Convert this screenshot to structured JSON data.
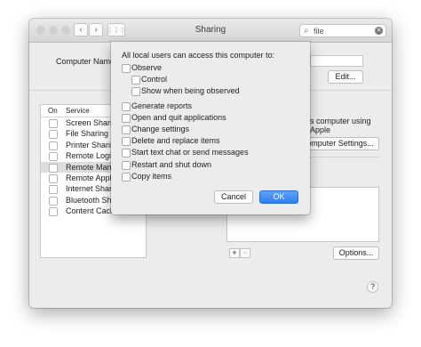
{
  "window": {
    "title": "Sharing",
    "search_value": "file",
    "nav_back": "‹",
    "nav_forward": "›",
    "grid": "⋮⋮⋮"
  },
  "colors": {
    "close": "#fc605c",
    "minimize": "#fdbc40",
    "zoom": "#34c84a",
    "accent": "#2f7ef2"
  },
  "computer_name": {
    "label": "Computer Name:",
    "edit_button": "Edit..."
  },
  "services": {
    "header_on": "On",
    "header_service": "Service",
    "items": [
      {
        "name": "Screen Sharing",
        "on": false,
        "selected": false
      },
      {
        "name": "File Sharing",
        "on": false,
        "selected": false
      },
      {
        "name": "Printer Sharing",
        "on": false,
        "selected": false
      },
      {
        "name": "Remote Login",
        "on": false,
        "selected": false
      },
      {
        "name": "Remote Manag",
        "on": false,
        "selected": true
      },
      {
        "name": "Remote Apple",
        "on": false,
        "selected": false
      },
      {
        "name": "Internet Sharing",
        "on": false,
        "selected": false
      },
      {
        "name": "Bluetooth Shar",
        "on": false,
        "selected": false
      },
      {
        "name": "Content Cachin",
        "on": false,
        "selected": false
      }
    ]
  },
  "detail": {
    "partial_text": "s computer using Apple",
    "computer_settings_button": "omputer Settings...",
    "plus": "+",
    "minus": "−",
    "options_button": "Options...",
    "help": "?"
  },
  "sheet": {
    "prompt": "All local users can access this computer to:",
    "options": [
      {
        "label": "Observe",
        "checked": false,
        "indent": 0
      },
      {
        "label": "Control",
        "checked": false,
        "indent": 1
      },
      {
        "label": "Show when being observed",
        "checked": false,
        "indent": 1
      },
      {
        "label": "Generate reports",
        "checked": false,
        "indent": 0
      },
      {
        "label": "Open and quit applications",
        "checked": false,
        "indent": 0
      },
      {
        "label": "Change settings",
        "checked": false,
        "indent": 0
      },
      {
        "label": "Delete and replace items",
        "checked": false,
        "indent": 0
      },
      {
        "label": "Start text chat or send messages",
        "checked": false,
        "indent": 0
      },
      {
        "label": "Restart and shut down",
        "checked": false,
        "indent": 0
      },
      {
        "label": "Copy items",
        "checked": false,
        "indent": 0
      }
    ],
    "cancel_button": "Cancel",
    "ok_button": "OK"
  }
}
